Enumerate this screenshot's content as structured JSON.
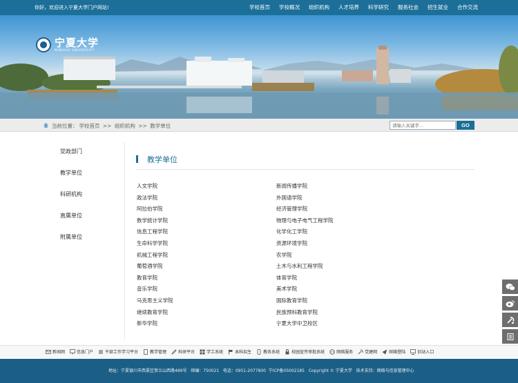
{
  "topbar": {
    "welcome": "你好，欢迎进入宁夏大学门户网站!",
    "nav": [
      "学校首页",
      "学校概况",
      "组织机构",
      "人才培养",
      "科学研究",
      "服务社会",
      "招生就业",
      "合作交流"
    ]
  },
  "logo": {
    "name_cn": "宁夏大学",
    "name_en": "NINGXIA UNIVERSITY"
  },
  "breadcrumb": {
    "prefix": "当前位置：",
    "items": [
      "学校首页",
      ">>",
      "组织机构",
      ">>",
      "教学单位"
    ]
  },
  "search": {
    "placeholder": "请输入关键字...",
    "button": "GO"
  },
  "sidebar": {
    "items": [
      "党政部门",
      "教学单位",
      "科研机构",
      "直属单位",
      "附属单位"
    ]
  },
  "section": {
    "title": "教学单位"
  },
  "units": {
    "left": [
      "人文学院",
      "政法学院",
      "阿拉伯学院",
      "数学统计学院",
      "信息工程学院",
      "生命科学学院",
      "机械工程学院",
      "葡萄酒学院",
      "教育学院",
      "音乐学院",
      "马克思主义学院",
      "继续教育学院",
      "新华学院"
    ],
    "right": [
      "新闻传播学院",
      "外国语学院",
      "经济管理学院",
      "物理与电子电气工程学院",
      "化学化工学院",
      "资源环境学院",
      "农学院",
      "土木与水利工程学院",
      "体育学院",
      "美术学院",
      "国际教育学院",
      "民族预科教育学院",
      "宁夏大学中卫校区"
    ]
  },
  "float_icons": [
    "wechat-icon",
    "weibo-icon",
    "party-icon",
    "book-icon"
  ],
  "links": [
    "新闻网",
    "信息门户",
    "干部工作学习平台",
    "教学管理",
    "科研平台",
    "学工系统",
    "本科招生",
    "教务系统",
    "校园宣传审批系统",
    "网络服务",
    "党建网",
    "邮箱登陆",
    "旧站入口"
  ],
  "footer": {
    "address": "地址：宁夏银川市西夏区贺兰山西路489号",
    "postcode": "邮编：750021",
    "phone": "电话：0951-2077800",
    "icp": "宁ICP备05002185",
    "copyright": "Copyright © 宁夏大学",
    "support": "技术支持：网络与信息管理中心"
  },
  "colors": {
    "brand": "#1b6f99",
    "footer": "#1c5f86",
    "float": "#6e6e6e"
  }
}
